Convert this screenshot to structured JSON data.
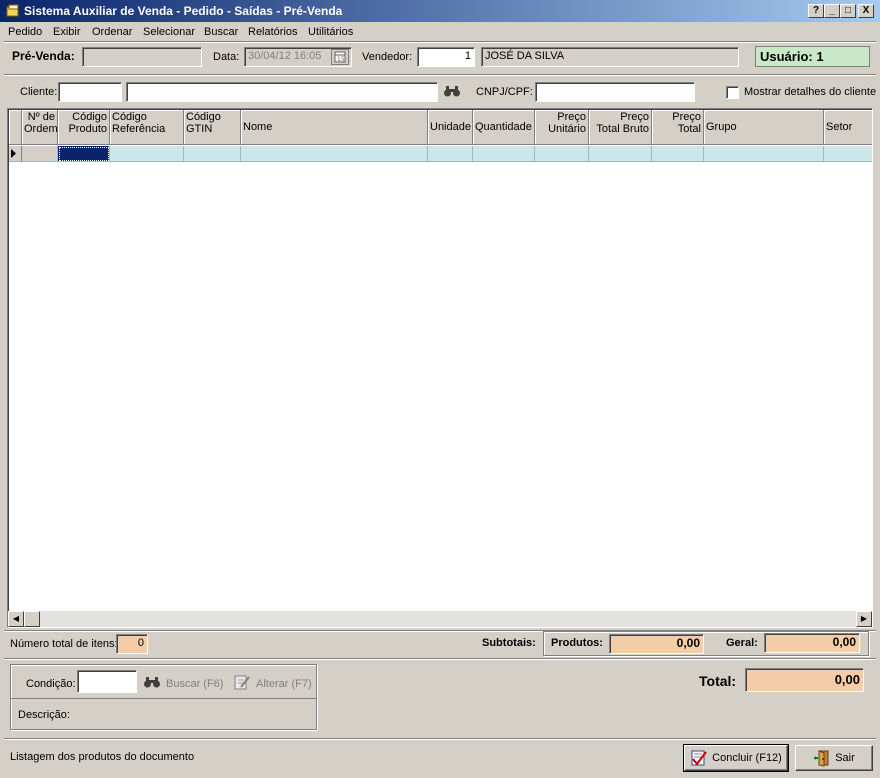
{
  "window": {
    "title": "Sistema Auxiliar de Venda - Pedido - Saídas - Pré-Venda",
    "buttons": [
      "?",
      "_",
      "□",
      "X"
    ]
  },
  "menu": [
    "Pedido",
    "Exibir",
    "Ordenar",
    "Selecionar",
    "Buscar",
    "Relatórios",
    "Utilitários"
  ],
  "header": {
    "prevenda_label": "Pré-Venda:",
    "prevenda_value": "",
    "data_label": "Data:",
    "data_value": "30/04/12 16:05",
    "vendedor_label": "Vendedor:",
    "vendedor_code": "1",
    "vendedor_name": "JOSÉ DA SILVA",
    "usuario": "Usuário: 1"
  },
  "client": {
    "cliente_label": "Cliente:",
    "cliente_code": "",
    "cliente_name": "",
    "cnpj_label": "CNPJ/CPF:",
    "cnpj_value": "",
    "details_label": "Mostrar detalhes do cliente",
    "details_checked": false
  },
  "grid": {
    "columns": [
      {
        "line1": "Nº de",
        "line2": "Ordem"
      },
      {
        "line1": "Código",
        "line2": "Produto"
      },
      {
        "line1": "Código",
        "line2": "Referência"
      },
      {
        "line1": "Código",
        "line2": "GTIN"
      },
      {
        "line1": "Nome",
        "line2": ""
      },
      {
        "line1": "Unidade",
        "line2": ""
      },
      {
        "line1": "Quantidade",
        "line2": ""
      },
      {
        "line1": "Preço",
        "line2": "Unitário"
      },
      {
        "line1": "Preço",
        "line2": "Total Bruto"
      },
      {
        "line1": "Preço",
        "line2": "Total"
      },
      {
        "line1": "Grupo",
        "line2": ""
      },
      {
        "line1": "Setor",
        "line2": ""
      }
    ]
  },
  "totals": {
    "num_itens_label": "Número total de itens:",
    "num_itens_value": "0",
    "subtotais_label": "Subtotais:",
    "produtos_label": "Produtos:",
    "produtos_value": "0,00",
    "geral_label": "Geral:",
    "geral_value": "0,00",
    "total_label": "Total:",
    "total_value": "0,00"
  },
  "condition": {
    "condicao_label": "Condição:",
    "condicao_value": "",
    "buscar_label": "Buscar (F6)",
    "alterar_label": "Alterar (F7)",
    "descricao_label": "Descrição:"
  },
  "status": {
    "text": "Listagem dos produtos do documento",
    "concluir_label": "Concluir (F12)",
    "sair_label": "Sair"
  }
}
